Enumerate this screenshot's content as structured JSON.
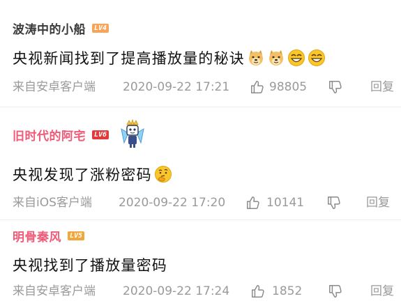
{
  "colors": {
    "username_gray": "#3a3a3a",
    "username_pink": "#f05a78",
    "meta_gray": "#9a9a9a",
    "text": "#111111"
  },
  "comments": [
    {
      "username": "波涛中的小船",
      "level": "LV4",
      "text": "央视新闻找到了提高播放量的秘诀",
      "emojis": [
        "doge-icon",
        "doge-icon",
        "grin-icon",
        "grin-icon"
      ],
      "source": "来自安卓客户端",
      "timestamp": "2020-09-22 17:21",
      "likes": "98805",
      "reply_label": "回复"
    },
    {
      "username": "旧时代的阿宅",
      "level": "LV6",
      "badge": "crown-robot-badge-icon",
      "text": "央视发现了涨粉密码",
      "emojis": [
        "thinking-face-icon"
      ],
      "source": "来自iOS客户端",
      "timestamp": "2020-09-22 17:20",
      "likes": "10141",
      "reply_label": "回复"
    },
    {
      "username": "明骨秦风",
      "level": "LV5",
      "text": "央视找到了播放量密码",
      "emojis": [],
      "source": "来自安卓客户端",
      "timestamp": "2020-09-22 17:24",
      "likes": "1852",
      "reply_label": "回复"
    }
  ]
}
